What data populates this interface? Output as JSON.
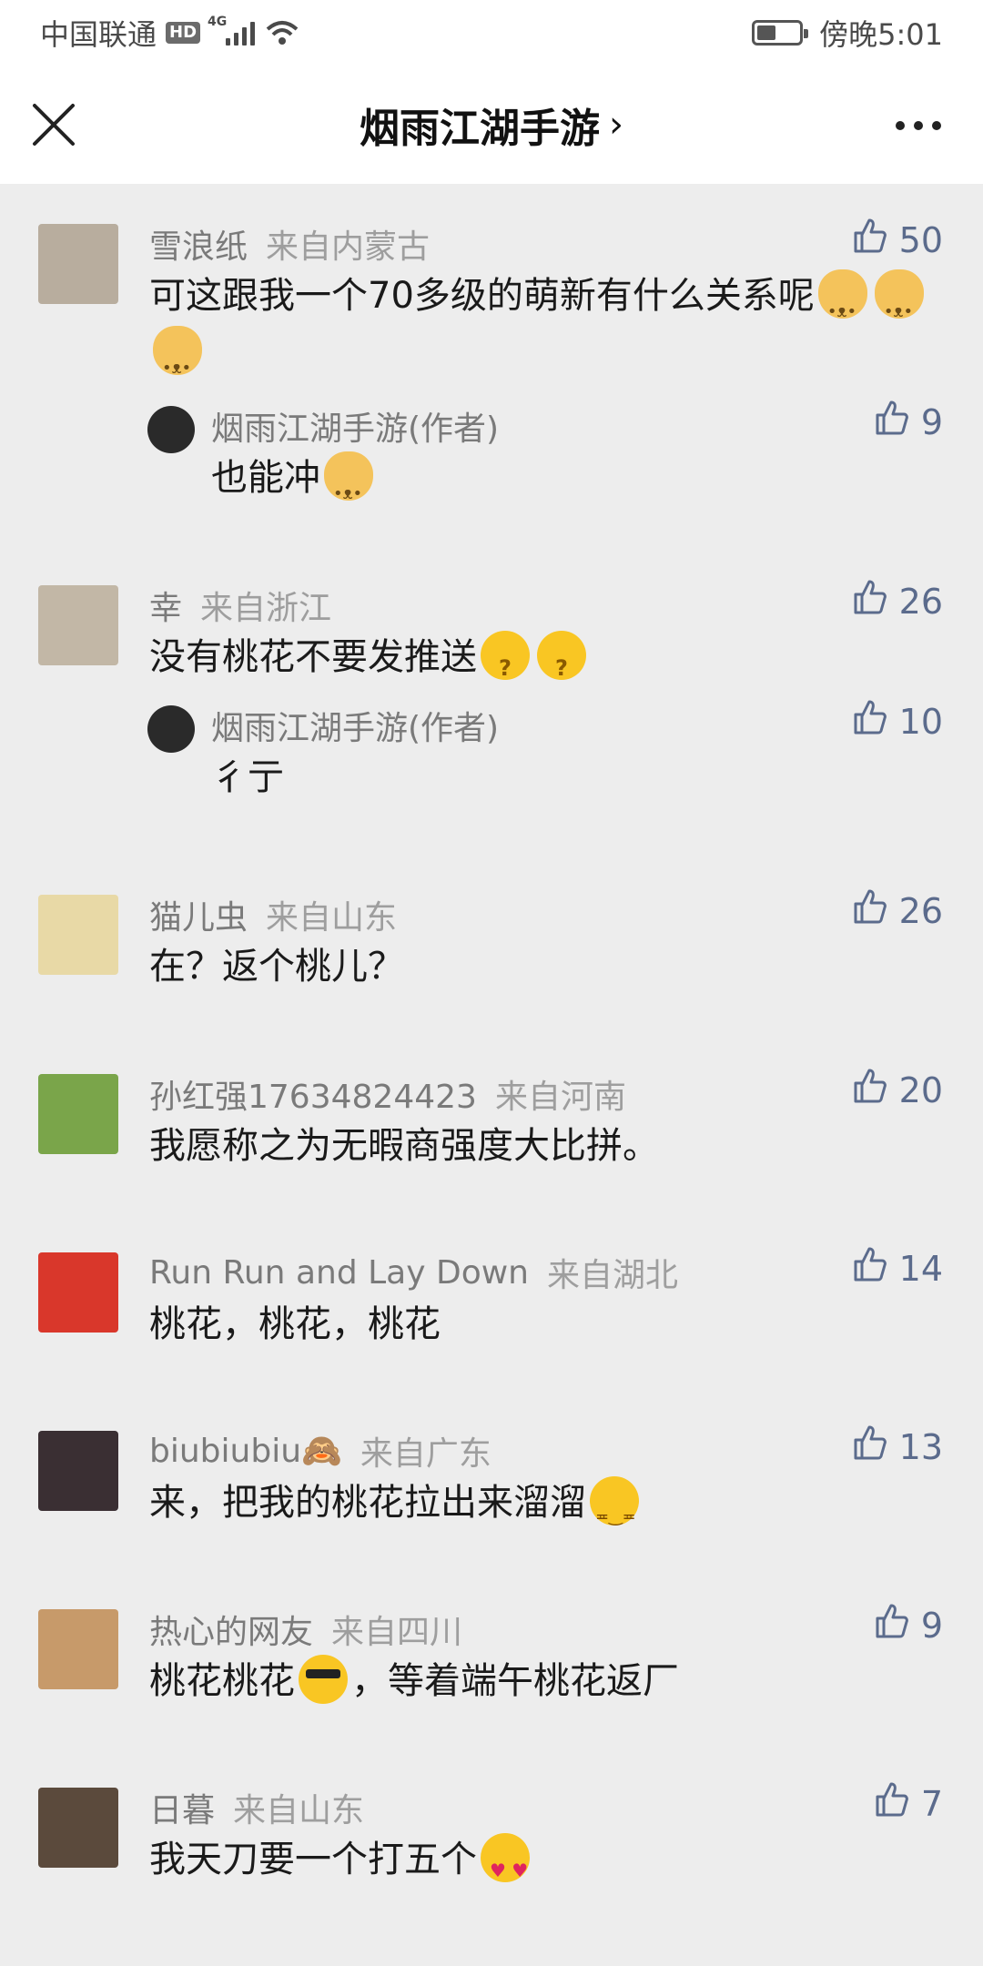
{
  "status_bar": {
    "carrier": "中国联通",
    "hd": "HD",
    "network": "4G",
    "time_label": "傍晚5:01",
    "battery_level": 0.45
  },
  "nav": {
    "title": "烟雨江湖手游",
    "chevron": "›",
    "close_icon": "close-icon",
    "more_icon": "more-dots-icon"
  },
  "comments": [
    {
      "author": "雪浪纸",
      "from": "来自内蒙古",
      "text": "可这跟我一个70多级的萌新有什么关系呢",
      "emojis": [
        "doge",
        "doge",
        "doge"
      ],
      "likes": "50",
      "avatar_color": "#b8ad9e",
      "reply": {
        "author": "烟雨江湖手游(作者)",
        "text": "也能冲",
        "emojis": [
          "doge"
        ],
        "likes": "9"
      }
    },
    {
      "author": "幸",
      "from": "来自浙江",
      "text": "没有桃花不要发推送",
      "emojis": [
        "confused",
        "confused"
      ],
      "likes": "26",
      "avatar_color": "#c2b7a6",
      "reply": {
        "author": "烟雨江湖手游(作者)",
        "text": "彳亍",
        "emojis": [],
        "likes": "10"
      }
    },
    {
      "author": "猫儿虫",
      "from": "来自山东",
      "text": "在？返个桃儿？",
      "emojis": [],
      "likes": "26",
      "avatar_color": "#e8d9a6"
    },
    {
      "author": "孙红强17634824423",
      "from": "来自河南",
      "text": "我愿称之为无暇商强度大比拼。",
      "emojis": [],
      "likes": "20",
      "avatar_color": "#7aa54a"
    },
    {
      "author": "Run Run and Lay Down",
      "from": "来自湖北",
      "text": "桃花，桃花，桃花",
      "emojis": [],
      "likes": "14",
      "avatar_color": "#d9372b"
    },
    {
      "author": "biubiubiu🙈",
      "from": "来自广东",
      "text": "来，把我的桃花拉出来溜溜",
      "emojis": [
        "smirk"
      ],
      "likes": "13",
      "avatar_color": "#3a2f33"
    },
    {
      "author": "热心的网友",
      "from": "来自四川",
      "text": "桃花桃花",
      "text_after": "，等着端午桃花返厂",
      "emojis": [
        "cool"
      ],
      "likes": "9",
      "avatar_color": "#c79a6a"
    },
    {
      "author": "日暮",
      "from": "来自山东",
      "text": "我天刀要一个打五个",
      "emojis": [
        "hearts"
      ],
      "likes": "7",
      "avatar_color": "#5b4a3c"
    }
  ]
}
